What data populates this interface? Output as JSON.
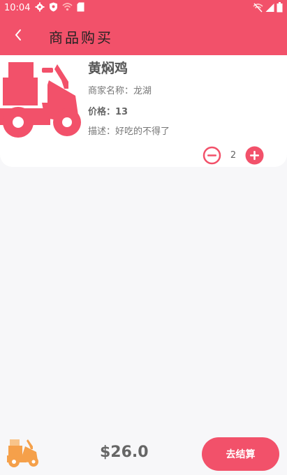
{
  "status_bar": {
    "time": "10:04",
    "left_icons": [
      "gear-icon",
      "shield-icon",
      "wifi-icon",
      "sdcard-icon"
    ],
    "right_icons": [
      "wifi-off-icon",
      "signal-icon",
      "battery-icon"
    ]
  },
  "header": {
    "title": "商品购买",
    "back_icon": "chevron-left-icon"
  },
  "product": {
    "name": "黄焖鸡",
    "merchant": "商家名称：龙湖",
    "price": "价格：13",
    "description": "描述：好吃的不得了",
    "image_icon": "delivery-scooter-icon",
    "quantity": "2"
  },
  "footer": {
    "total": "$26.0",
    "checkout_label": "去结算",
    "cart_icon": "delivery-scooter-icon"
  },
  "colors": {
    "accent": "#f2516a",
    "cart_icon_orange": "#f5a04a",
    "background": "#f7f7f9"
  }
}
